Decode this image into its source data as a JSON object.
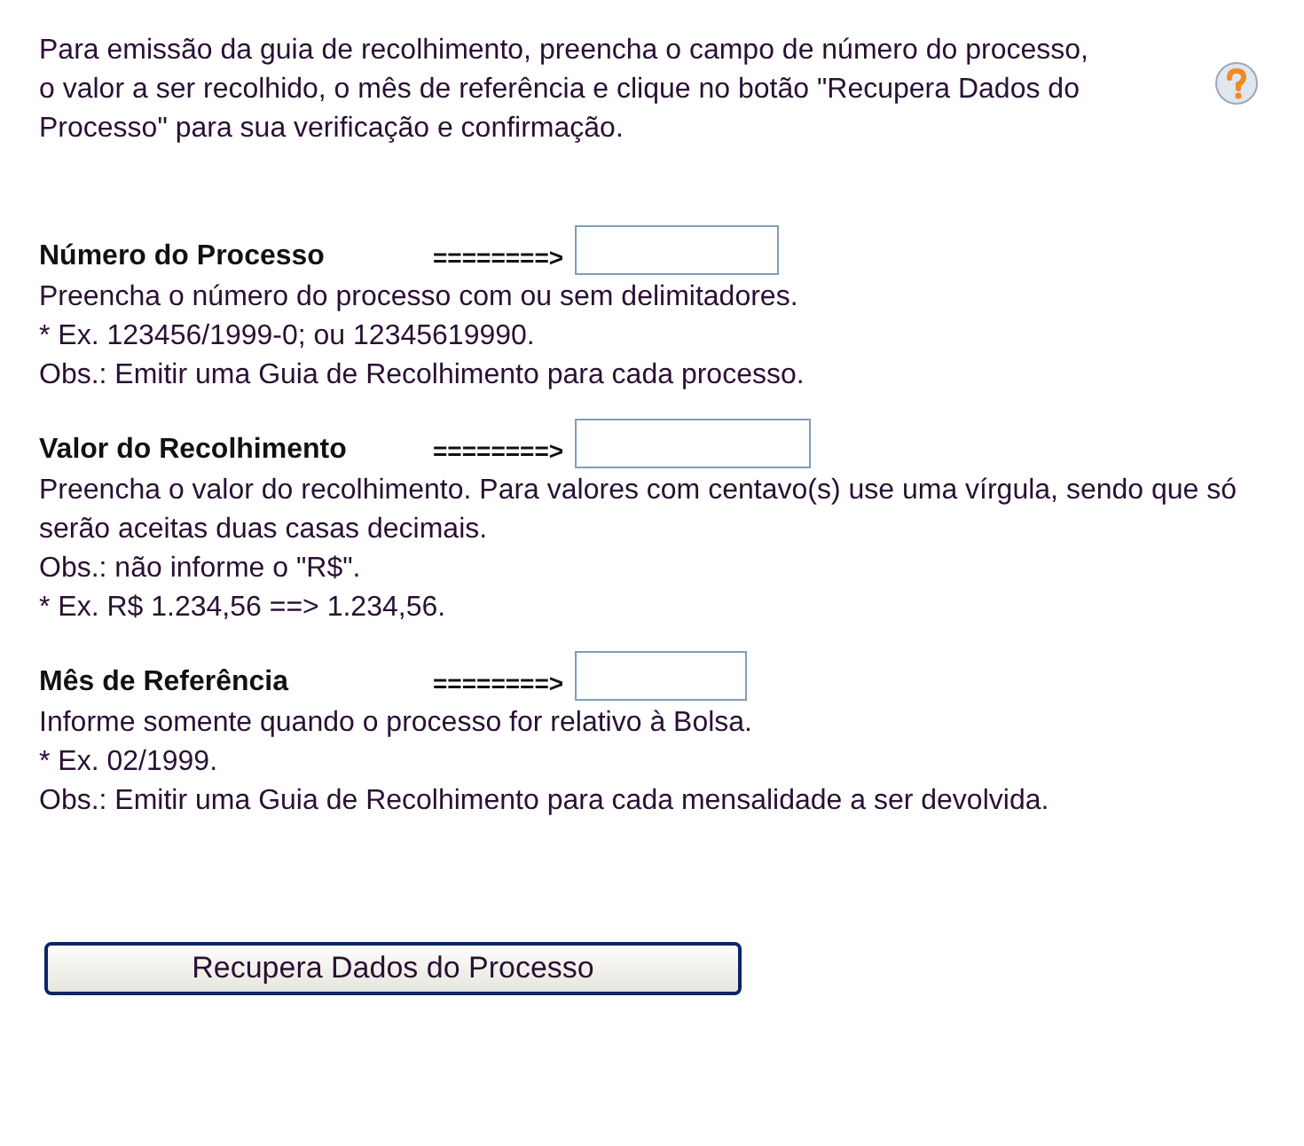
{
  "intro": "Para emissão da guia de recolhimento, preencha o campo de número do processo, o valor a ser recolhido, o mês de referência e clique no botão \"Recupera Dados do Processo\" para sua verificação e confirmação.",
  "sections": [
    {
      "label": "Número do Processo",
      "arrow": "========>",
      "notes": [
        "Preencha o número do processo com ou sem delimitadores.",
        "* Ex. 123456/1999-0; ou 12345619990.",
        "Obs.: Emitir uma Guia de Recolhimento para cada processo."
      ]
    },
    {
      "label": "Valor do Recolhimento",
      "arrow": "========>",
      "notes": [
        "Preencha o valor do recolhimento. Para valores com centavo(s) use uma vírgula, sendo que só serão aceitas duas casas decimais.",
        "Obs.: não informe o \"R$\".",
        "* Ex. R$ 1.234,56 ==> 1.234,56."
      ]
    },
    {
      "label": "Mês de Referência",
      "arrow": "========>",
      "notes": [
        "Informe somente quando o processo for relativo à Bolsa.",
        "* Ex. 02/1999.",
        "Obs.: Emitir uma Guia de Recolhimento para cada mensalidade a ser devolvida."
      ]
    }
  ],
  "button": "Recupera Dados do Processo"
}
